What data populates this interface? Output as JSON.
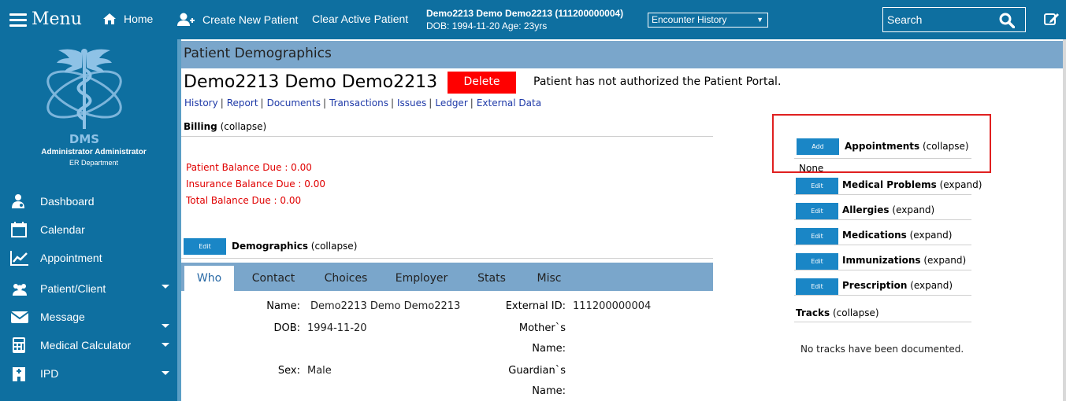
{
  "topbar": {
    "menu_label": "Menu",
    "home_label": "Home",
    "create_patient_label": "Create New Patient",
    "clear_patient_label": "Clear Active Patient",
    "patient_name_line": "Demo2213 Demo Demo2213 (111200000004)",
    "patient_dob_line": "DOB: 1994-11-20 Age: 23yrs",
    "encounter_select": "Encounter History",
    "search_placeholder": "Search"
  },
  "sidebar": {
    "logo_text": "DMS",
    "user_name": "Administrator Administrator",
    "user_dept": "ER Department",
    "items": [
      {
        "label": "Dashboard",
        "icon": "doctor-icon"
      },
      {
        "label": "Calendar",
        "icon": "calendar-icon"
      },
      {
        "label": "Appointment",
        "icon": "chart-line-icon"
      },
      {
        "label": "Patient/Client",
        "icon": "users-icon"
      },
      {
        "label": "Message",
        "icon": "envelope-icon"
      },
      {
        "label": "Medical Calculator",
        "icon": "calculator-icon"
      },
      {
        "label": "IPD",
        "icon": "hospital-icon"
      }
    ]
  },
  "main": {
    "header": "Patient Demographics",
    "patient_full_name": "Demo2213 Demo Demo2213",
    "delete_label": "Delete",
    "portal_message": "Patient has not authorized the Patient Portal.",
    "links": [
      "History",
      "Report",
      "Documents",
      "Transactions",
      "Issues",
      "Ledger",
      "External Data"
    ],
    "billing": {
      "title": "Billing",
      "toggle": "(collapse)",
      "patient_balance": "Patient Balance Due : 0.00",
      "insurance_balance": "Insurance Balance Due : 0.00",
      "total_balance": "Total Balance Due : 0.00"
    },
    "demographics": {
      "edit_label": "Edit",
      "title": "Demographics",
      "toggle": "(collapse)",
      "tabs": [
        "Who",
        "Contact",
        "Choices",
        "Employer",
        "Stats",
        "Misc"
      ],
      "fields": {
        "name_label": "Name:",
        "name_value": "Demo2213 Demo Demo2213",
        "dob_label": "DOB:",
        "dob_value": "1994-11-20",
        "sex_label": "Sex:",
        "sex_value": "Male",
        "external_id_label": "External ID:",
        "external_id_value": "111200000004",
        "mother_label_1": "Mother`s",
        "mother_label_2": "Name:",
        "guardian_label_1": "Guardian`s",
        "guardian_label_2": "Name:"
      }
    }
  },
  "right_panel": {
    "appointments": {
      "button": "Add",
      "title": "Appointments",
      "toggle": "(collapse)",
      "content": "None"
    },
    "medical_problems": {
      "button": "Edit",
      "title": "Medical Problems",
      "toggle": "(expand)"
    },
    "allergies": {
      "button": "Edit",
      "title": "Allergies",
      "toggle": "(expand)"
    },
    "medications": {
      "button": "Edit",
      "title": "Medications",
      "toggle": "(expand)"
    },
    "immunizations": {
      "button": "Edit",
      "title": "Immunizations",
      "toggle": "(expand)"
    },
    "prescription": {
      "button": "Edit",
      "title": "Prescription",
      "toggle": "(expand)"
    },
    "tracks": {
      "title": "Tracks",
      "toggle": "(collapse)",
      "content": "No tracks have been documented."
    }
  },
  "colors": {
    "brand_blue": "#0e6fa0",
    "header_blue": "#7aa6cb",
    "button_blue": "#1a86c6",
    "delete_red": "#ff0000",
    "balance_red": "#e00000",
    "highlight_box": "#e02020"
  }
}
